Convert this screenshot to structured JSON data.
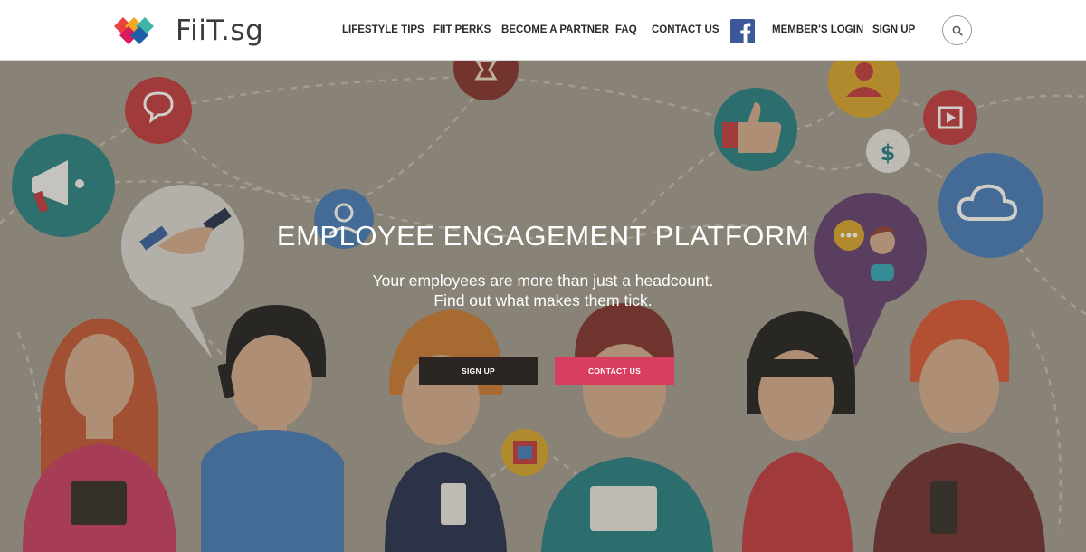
{
  "brand": {
    "name": "FiiT.sg"
  },
  "nav": {
    "items": [
      {
        "label": "LIFESTYLE TIPS"
      },
      {
        "label": "FIIT PERKS"
      },
      {
        "label": "BECOME A PARTNER"
      },
      {
        "label": "FAQ"
      },
      {
        "label": "CONTACT US"
      },
      {
        "label": "MEMBER'S LOGIN"
      },
      {
        "label": "SIGN UP"
      }
    ],
    "facebook_icon": "facebook-icon",
    "search_icon": "search-icon"
  },
  "hero": {
    "title": "EMPLOYEE ENGAGEMENT PLATFORM",
    "subtitle_line1": "Your employees are more than just a headcount.",
    "subtitle_line2": "Find out what makes them tick.",
    "signup_label": "SIGN UP",
    "contact_label": "CONTACT US"
  },
  "colors": {
    "hero_bg": "#9d978c",
    "signup_button": "#2c2622",
    "contact_button": "#d83e5d",
    "facebook": "#3b5998"
  }
}
